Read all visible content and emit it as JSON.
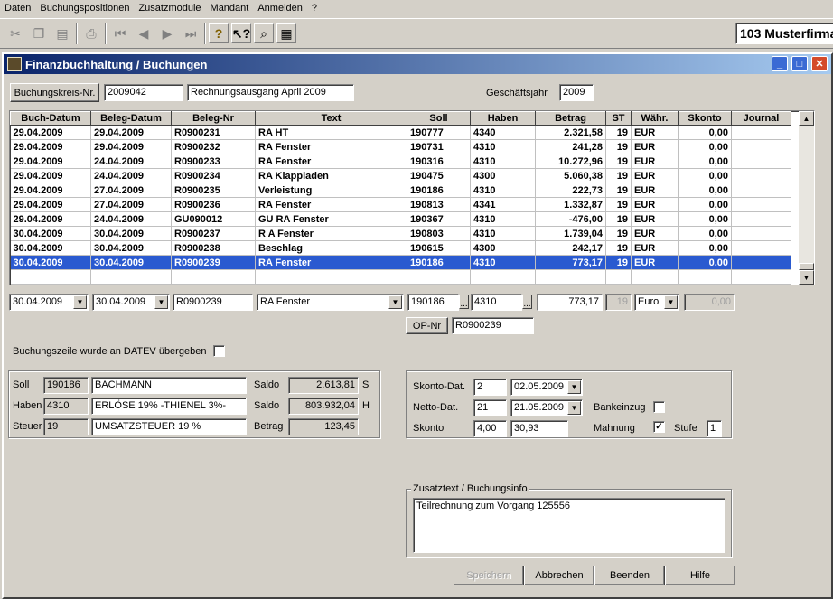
{
  "menu": [
    "Daten",
    "Buchungspositionen",
    "Zusatzmodule",
    "Mandant",
    "Anmelden",
    "?"
  ],
  "company": "103 Musterfirma",
  "window": {
    "title": "Finanzbuchhaltung / Buchungen"
  },
  "header": {
    "buchungskreis_button": "Buchungskreis-Nr.",
    "buchungskreis_value": "2009042",
    "description": "Rechnungsausgang April 2009",
    "geschaeftsjahr_label": "Geschäftsjahr",
    "geschaeftsjahr_value": "2009"
  },
  "table": {
    "columns": [
      "Buch-Datum",
      "Beleg-Datum",
      "Beleg-Nr",
      "Text",
      "Soll",
      "Haben",
      "Betrag",
      "ST",
      "Währ.",
      "Skonto",
      "Journal"
    ],
    "rows": [
      [
        "29.04.2009",
        "29.04.2009",
        "R0900231",
        "RA HT",
        "190777",
        "4340",
        "2.321,58",
        "19",
        "EUR",
        "0,00",
        ""
      ],
      [
        "29.04.2009",
        "29.04.2009",
        "R0900232",
        "RA Fenster",
        "190731",
        "4310",
        "241,28",
        "19",
        "EUR",
        "0,00",
        ""
      ],
      [
        "29.04.2009",
        "24.04.2009",
        "R0900233",
        "RA Fenster",
        "190316",
        "4310",
        "10.272,96",
        "19",
        "EUR",
        "0,00",
        ""
      ],
      [
        "29.04.2009",
        "24.04.2009",
        "R0900234",
        "RA Klappladen",
        "190475",
        "4300",
        "5.060,38",
        "19",
        "EUR",
        "0,00",
        ""
      ],
      [
        "29.04.2009",
        "27.04.2009",
        "R0900235",
        "Verleistung",
        "190186",
        "4310",
        "222,73",
        "19",
        "EUR",
        "0,00",
        ""
      ],
      [
        "29.04.2009",
        "27.04.2009",
        "R0900236",
        "RA Fenster",
        "190813",
        "4341",
        "1.332,87",
        "19",
        "EUR",
        "0,00",
        ""
      ],
      [
        "29.04.2009",
        "24.04.2009",
        "GU090012",
        "GU RA Fenster",
        "190367",
        "4310",
        "-476,00",
        "19",
        "EUR",
        "0,00",
        ""
      ],
      [
        "30.04.2009",
        "30.04.2009",
        "R0900237",
        "R A Fenster",
        "190803",
        "4310",
        "1.739,04",
        "19",
        "EUR",
        "0,00",
        ""
      ],
      [
        "30.04.2009",
        "30.04.2009",
        "R0900238",
        "Beschlag",
        "190615",
        "4300",
        "242,17",
        "19",
        "EUR",
        "0,00",
        ""
      ],
      [
        "30.04.2009",
        "30.04.2009",
        "R0900239",
        "RA Fenster",
        "190186",
        "4310",
        "773,17",
        "19",
        "EUR",
        "0,00",
        ""
      ]
    ],
    "selected_row": 9
  },
  "edit": {
    "buch_datum": "30.04.2009",
    "beleg_datum": "30.04.2009",
    "beleg_nr": "R0900239",
    "text": "RA Fenster",
    "soll": "190186",
    "haben": "4310",
    "betrag": "773,17",
    "st": "19",
    "waehrung": "Euro",
    "skonto": "0,00",
    "op_nr_button": "OP-Nr",
    "op_nr_value": "R0900239"
  },
  "datev": {
    "label": "Buchungszeile wurde an DATEV übergeben",
    "checked": false
  },
  "accounts": {
    "soll_label": "Soll",
    "soll_nr": "190186",
    "soll_name": "BACHMANN",
    "haben_label": "Haben",
    "haben_nr": "4310",
    "haben_name": "ERLÖSE 19% -THIENEL 3%-",
    "steuer_label": "Steuer",
    "steuer_nr": "19",
    "steuer_name": "UMSATZSTEUER 19 %",
    "saldo_label": "Saldo",
    "saldo1": "2.613,81",
    "saldo1_unit": "S",
    "saldo2": "803.932,04",
    "saldo2_unit": "H",
    "betrag_label": "Betrag",
    "betrag": "123,45"
  },
  "terms": {
    "skonto_dat_label": "Skonto-Dat.",
    "skonto_days": "2",
    "skonto_date": "02.05.2009",
    "netto_dat_label": "Netto-Dat.",
    "netto_days": "21",
    "netto_date": "21.05.2009",
    "skonto_label": "Skonto",
    "skonto_pct": "4,00",
    "skonto_amount": "30,93",
    "bankeinzug_label": "Bankeinzug",
    "bankeinzug_checked": false,
    "mahnung_label": "Mahnung",
    "mahnung_checked": true,
    "stufe_label": "Stufe",
    "stufe": "1"
  },
  "zusatz": {
    "title": "Zusatztext / Buchungsinfo",
    "text": "Teilrechnung zum Vorgang 125556"
  },
  "buttons": {
    "speichern": "Speichern",
    "abbrechen": "Abbrechen",
    "beenden": "Beenden",
    "hilfe": "Hilfe"
  }
}
